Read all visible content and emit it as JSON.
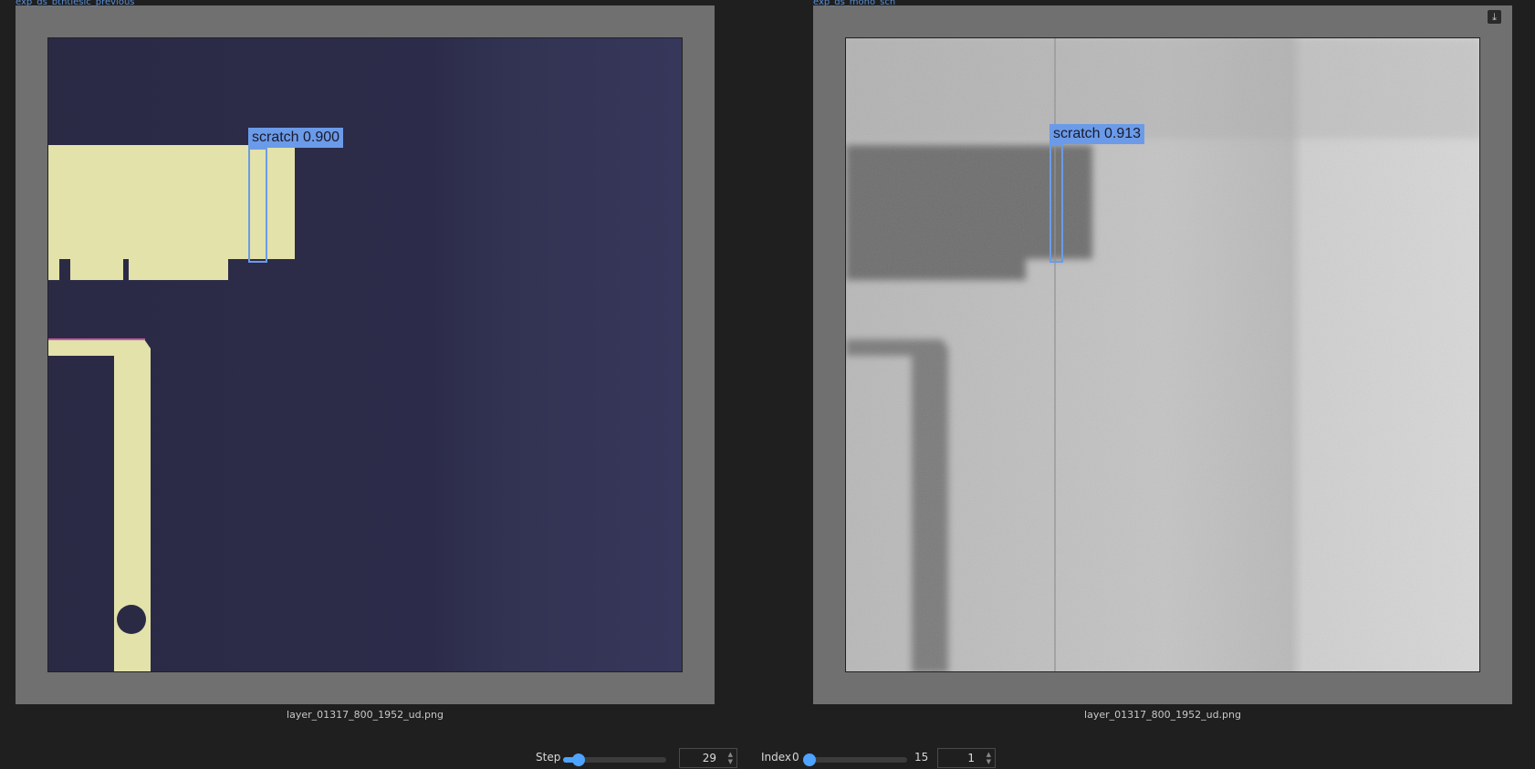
{
  "panels": {
    "left": {
      "title": "exp_ds_bthtiesic_previous",
      "caption": "layer_01317_800_1952_ud.png",
      "detection": {
        "label": "scratch 0.900"
      }
    },
    "right": {
      "title": "exp_ds_mono_sch",
      "caption": "layer_01317_800_1952_ud.png",
      "detection": {
        "label": "scratch 0.913"
      },
      "download_icon": "download-icon"
    }
  },
  "controls": {
    "step": {
      "label": "Step",
      "value": "29",
      "fraction": 0.15
    },
    "index": {
      "label": "Index",
      "min": "0",
      "max": "15",
      "value": "1",
      "fraction": 0.04
    }
  },
  "colors": {
    "accent": "#4da3ff",
    "detection": "#6b9be8",
    "panel_bg": "#707070",
    "page_bg": "#1f1f1f"
  }
}
